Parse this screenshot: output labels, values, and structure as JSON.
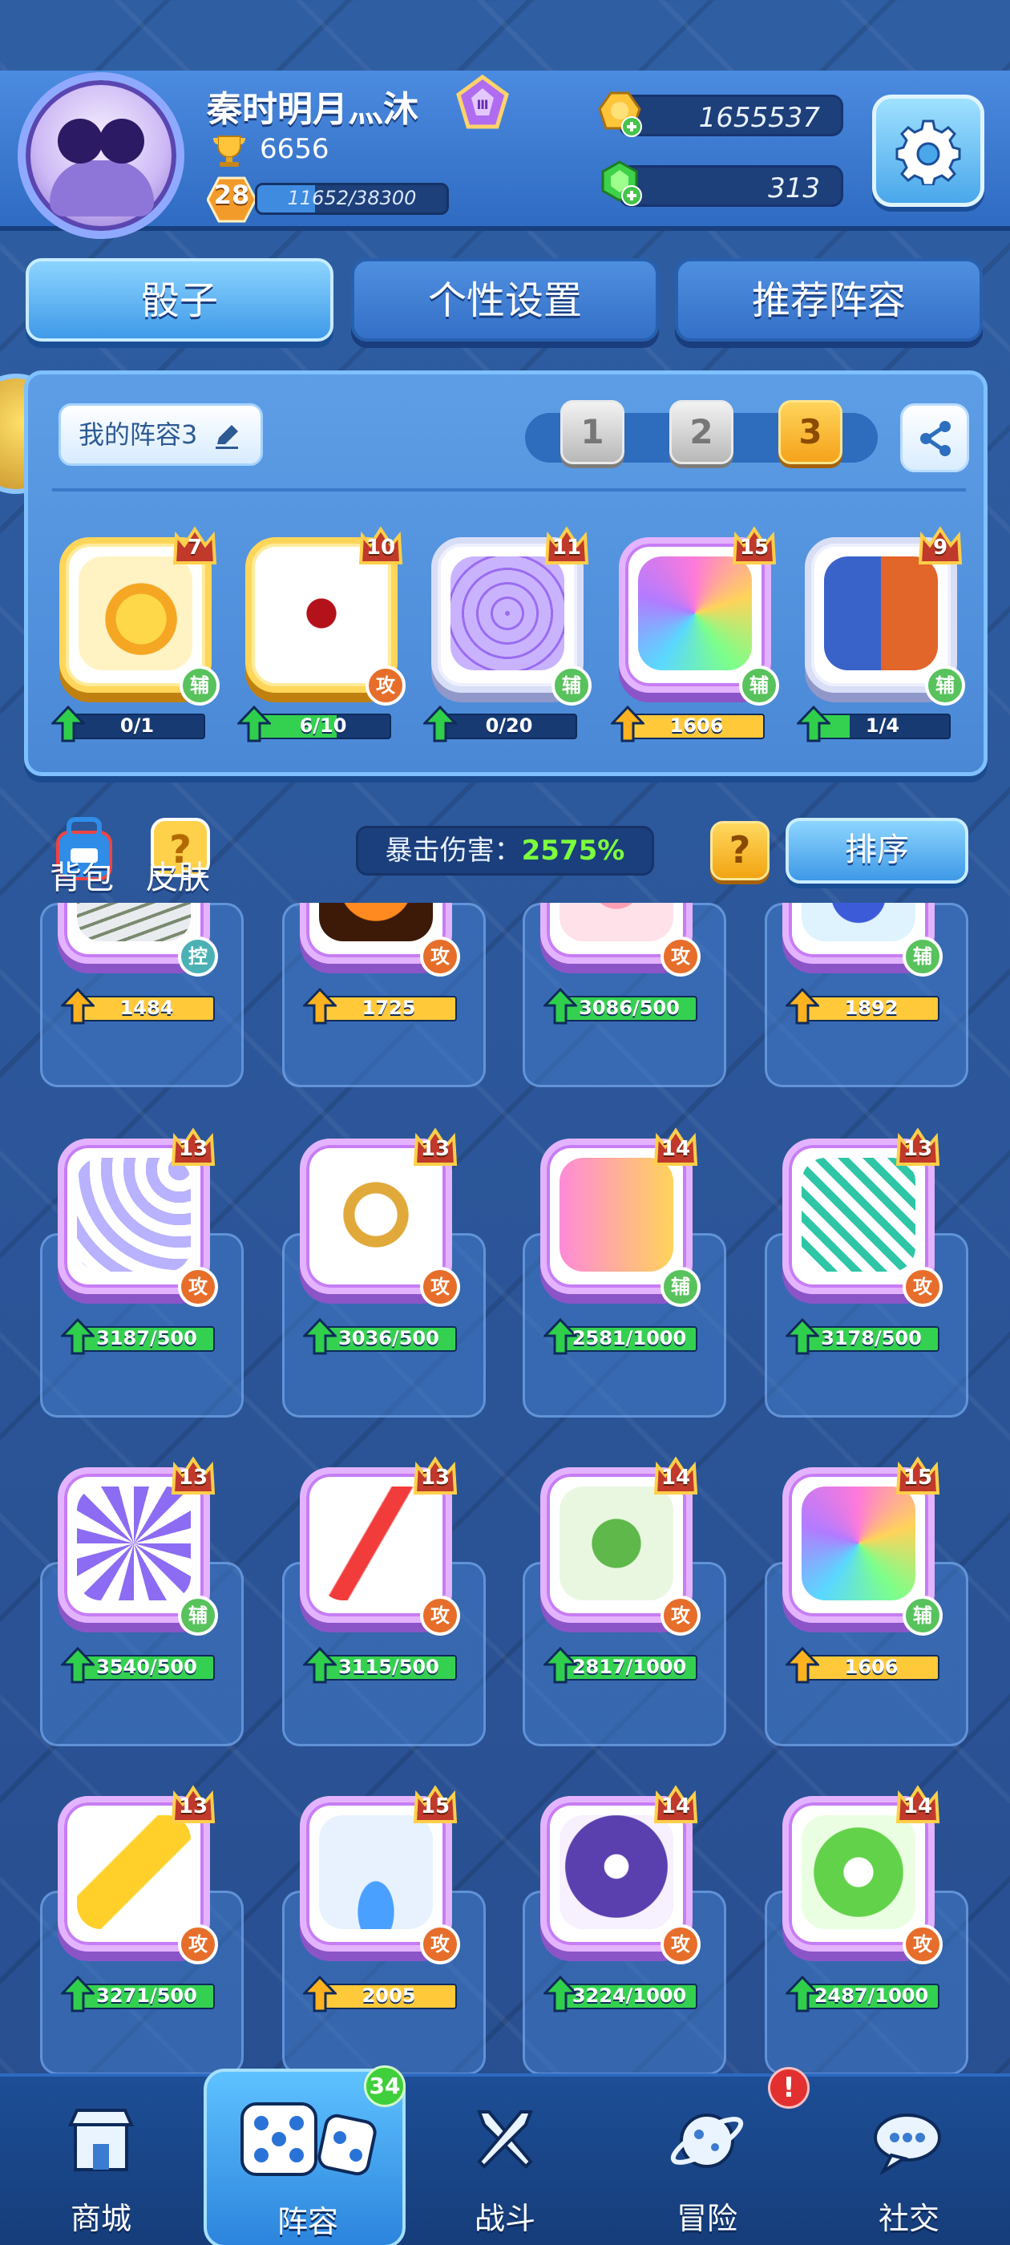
{
  "profile": {
    "nickname": "秦时明月灬沐",
    "trophies": "6656",
    "level": "28",
    "xp": "11652/38300",
    "xp_fraction": 0.304,
    "gold": "1655537",
    "gems": "313"
  },
  "tabs": [
    {
      "label": "骰子",
      "active": true
    },
    {
      "label": "个性设置",
      "active": false
    },
    {
      "label": "推荐阵容",
      "active": false
    }
  ],
  "deck": {
    "name": "我的阵容3",
    "slots": [
      "1",
      "2",
      "3"
    ],
    "active_slot": "3",
    "cards": [
      {
        "level": "7",
        "role": "辅",
        "progress": "0/1",
        "fraction": 0.0,
        "bar": "green",
        "style": "gold",
        "art": "coin-dice"
      },
      {
        "level": "10",
        "role": "攻",
        "progress": "6/10",
        "fraction": 0.6,
        "bar": "green",
        "style": "gold",
        "art": "blood-shuriken-dice"
      },
      {
        "level": "11",
        "role": "辅",
        "progress": "0/20",
        "fraction": 0.0,
        "bar": "green",
        "style": "silver",
        "art": "web-dice"
      },
      {
        "level": "15",
        "role": "辅",
        "progress": "1606",
        "fraction": 1.0,
        "bar": "yellow",
        "style": "purple",
        "art": "rainbow-puzzle-dice"
      },
      {
        "level": "9",
        "role": "辅",
        "progress": "1/4",
        "fraction": 0.25,
        "bar": "green",
        "style": "silver",
        "art": "twin-figure-dice"
      }
    ]
  },
  "collection_header": {
    "bag_label": "背包",
    "skin_label": "皮肤",
    "crit_label": "暴击伤害：",
    "crit_value": "2575%",
    "help_label": "?",
    "sort_label": "排序"
  },
  "collection": [
    {
      "level": "",
      "role": "控",
      "progress": "1484",
      "fraction": 1.0,
      "bar": "yellow",
      "art": "mummy-dice"
    },
    {
      "level": "",
      "role": "攻",
      "progress": "1725",
      "fraction": 1.0,
      "bar": "yellow",
      "art": "fire-dice"
    },
    {
      "level": "",
      "role": "攻",
      "progress": "3086/500",
      "fraction": 1.0,
      "bar": "green",
      "art": "flame-swirl-dice"
    },
    {
      "level": "",
      "role": "辅",
      "progress": "1892",
      "fraction": 1.0,
      "bar": "yellow",
      "art": "magic-hat-dice"
    },
    {
      "level": "13",
      "role": "攻",
      "progress": "3187/500",
      "fraction": 1.0,
      "bar": "green",
      "art": "wind-arc-dice"
    },
    {
      "level": "13",
      "role": "攻",
      "progress": "3036/500",
      "fraction": 1.0,
      "bar": "green",
      "art": "gear-dice"
    },
    {
      "level": "14",
      "role": "辅",
      "progress": "2581/1000",
      "fraction": 1.0,
      "bar": "green",
      "art": "cycle-dice"
    },
    {
      "level": "13",
      "role": "攻",
      "progress": "3178/500",
      "fraction": 1.0,
      "bar": "green",
      "art": "wave-dice"
    },
    {
      "level": "13",
      "role": "辅",
      "progress": "3540/500",
      "fraction": 1.0,
      "bar": "green",
      "art": "spiral-star-dice"
    },
    {
      "level": "13",
      "role": "攻",
      "progress": "3115/500",
      "fraction": 1.0,
      "bar": "green",
      "art": "lightning-dice"
    },
    {
      "level": "14",
      "role": "攻",
      "progress": "2817/1000",
      "fraction": 1.0,
      "bar": "green",
      "art": "virus-dice"
    },
    {
      "level": "15",
      "role": "辅",
      "progress": "1606",
      "fraction": 1.0,
      "bar": "yellow",
      "art": "rainbow-puzzle-dice"
    },
    {
      "level": "13",
      "role": "攻",
      "progress": "3271/500",
      "fraction": 1.0,
      "bar": "green",
      "art": "thunder-arrow-dice"
    },
    {
      "level": "15",
      "role": "攻",
      "progress": "2005",
      "fraction": 1.0,
      "bar": "yellow",
      "art": "portal-cube-dice"
    },
    {
      "level": "14",
      "role": "攻",
      "progress": "3224/1000",
      "fraction": 1.0,
      "bar": "green",
      "art": "reaper-dice"
    },
    {
      "level": "14",
      "role": "攻",
      "progress": "2487/1000",
      "fraction": 1.0,
      "bar": "green",
      "art": "thorn-dice"
    }
  ],
  "nav": [
    {
      "label": "商城",
      "icon": "shop-icon",
      "active": false
    },
    {
      "label": "阵容",
      "icon": "dice-icon",
      "active": true,
      "badge": "34"
    },
    {
      "label": "战斗",
      "icon": "swords-icon",
      "active": false
    },
    {
      "label": "冒险",
      "icon": "planet-icon",
      "active": false
    },
    {
      "label": "社交",
      "icon": "chat-icon",
      "active": false
    }
  ],
  "alert_badge": "!",
  "colors": {
    "background": "#2a4f8c",
    "accent_blue": "#3f9ae8",
    "gold_button": "#f5a31a",
    "progress_green": "#34d150",
    "progress_yellow": "#ffc93a",
    "attack_role": "#e66e2a",
    "support_role": "#58c25c",
    "control_role": "#4bb1b5"
  }
}
